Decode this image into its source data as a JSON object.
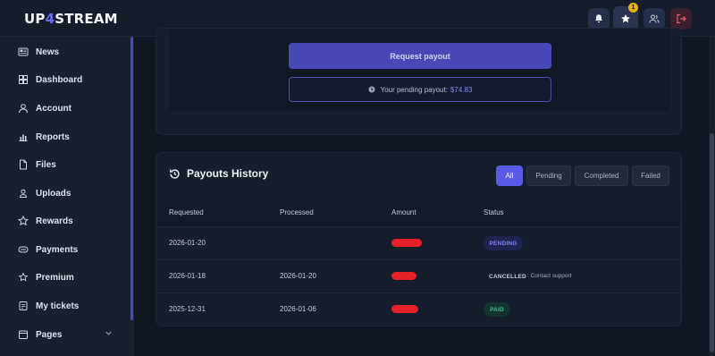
{
  "app": {
    "logo_pre": "UP",
    "logo_accent": "4",
    "logo_post": "STREAM",
    "notification_count": "1"
  },
  "sidebar": {
    "items": [
      {
        "label": "News",
        "icon": "newspaper-icon"
      },
      {
        "label": "Dashboard",
        "icon": "dashboard-icon"
      },
      {
        "label": "Account",
        "icon": "user-icon"
      },
      {
        "label": "Reports",
        "icon": "chart-icon"
      },
      {
        "label": "Files",
        "icon": "file-icon"
      },
      {
        "label": "Uploads",
        "icon": "upload-user-icon"
      },
      {
        "label": "Rewards",
        "icon": "star-icon"
      },
      {
        "label": "Payments",
        "icon": "money-icon"
      },
      {
        "label": "Premium",
        "icon": "star-outline-icon"
      },
      {
        "label": "My tickets",
        "icon": "ticket-icon"
      },
      {
        "label": "Pages",
        "icon": "pages-icon"
      }
    ]
  },
  "payout": {
    "request_label": "Request payout",
    "pending_label": "Your pending payout:",
    "pending_amount": "$74.83"
  },
  "history": {
    "title": "Payouts History",
    "filters": [
      "All",
      "Pending",
      "Completed",
      "Failed"
    ],
    "active_filter": "All",
    "columns": [
      "Requested",
      "Processed",
      "Amount",
      "Status"
    ],
    "rows": [
      {
        "requested": "2026-01-20",
        "processed": "",
        "status": "PENDING",
        "note": ""
      },
      {
        "requested": "2026-01-18",
        "processed": "2026-01-20",
        "status": "CANCELLED",
        "note": ": Contact support"
      },
      {
        "requested": "2025-12-31",
        "processed": "2026-01-06",
        "status": "PAID",
        "note": ""
      }
    ]
  },
  "colors": {
    "accent": "#5a5ae6",
    "pending": "#8088ee",
    "paid": "#37c493",
    "redaction": "#e8202a",
    "badge": "#e7b10e"
  }
}
